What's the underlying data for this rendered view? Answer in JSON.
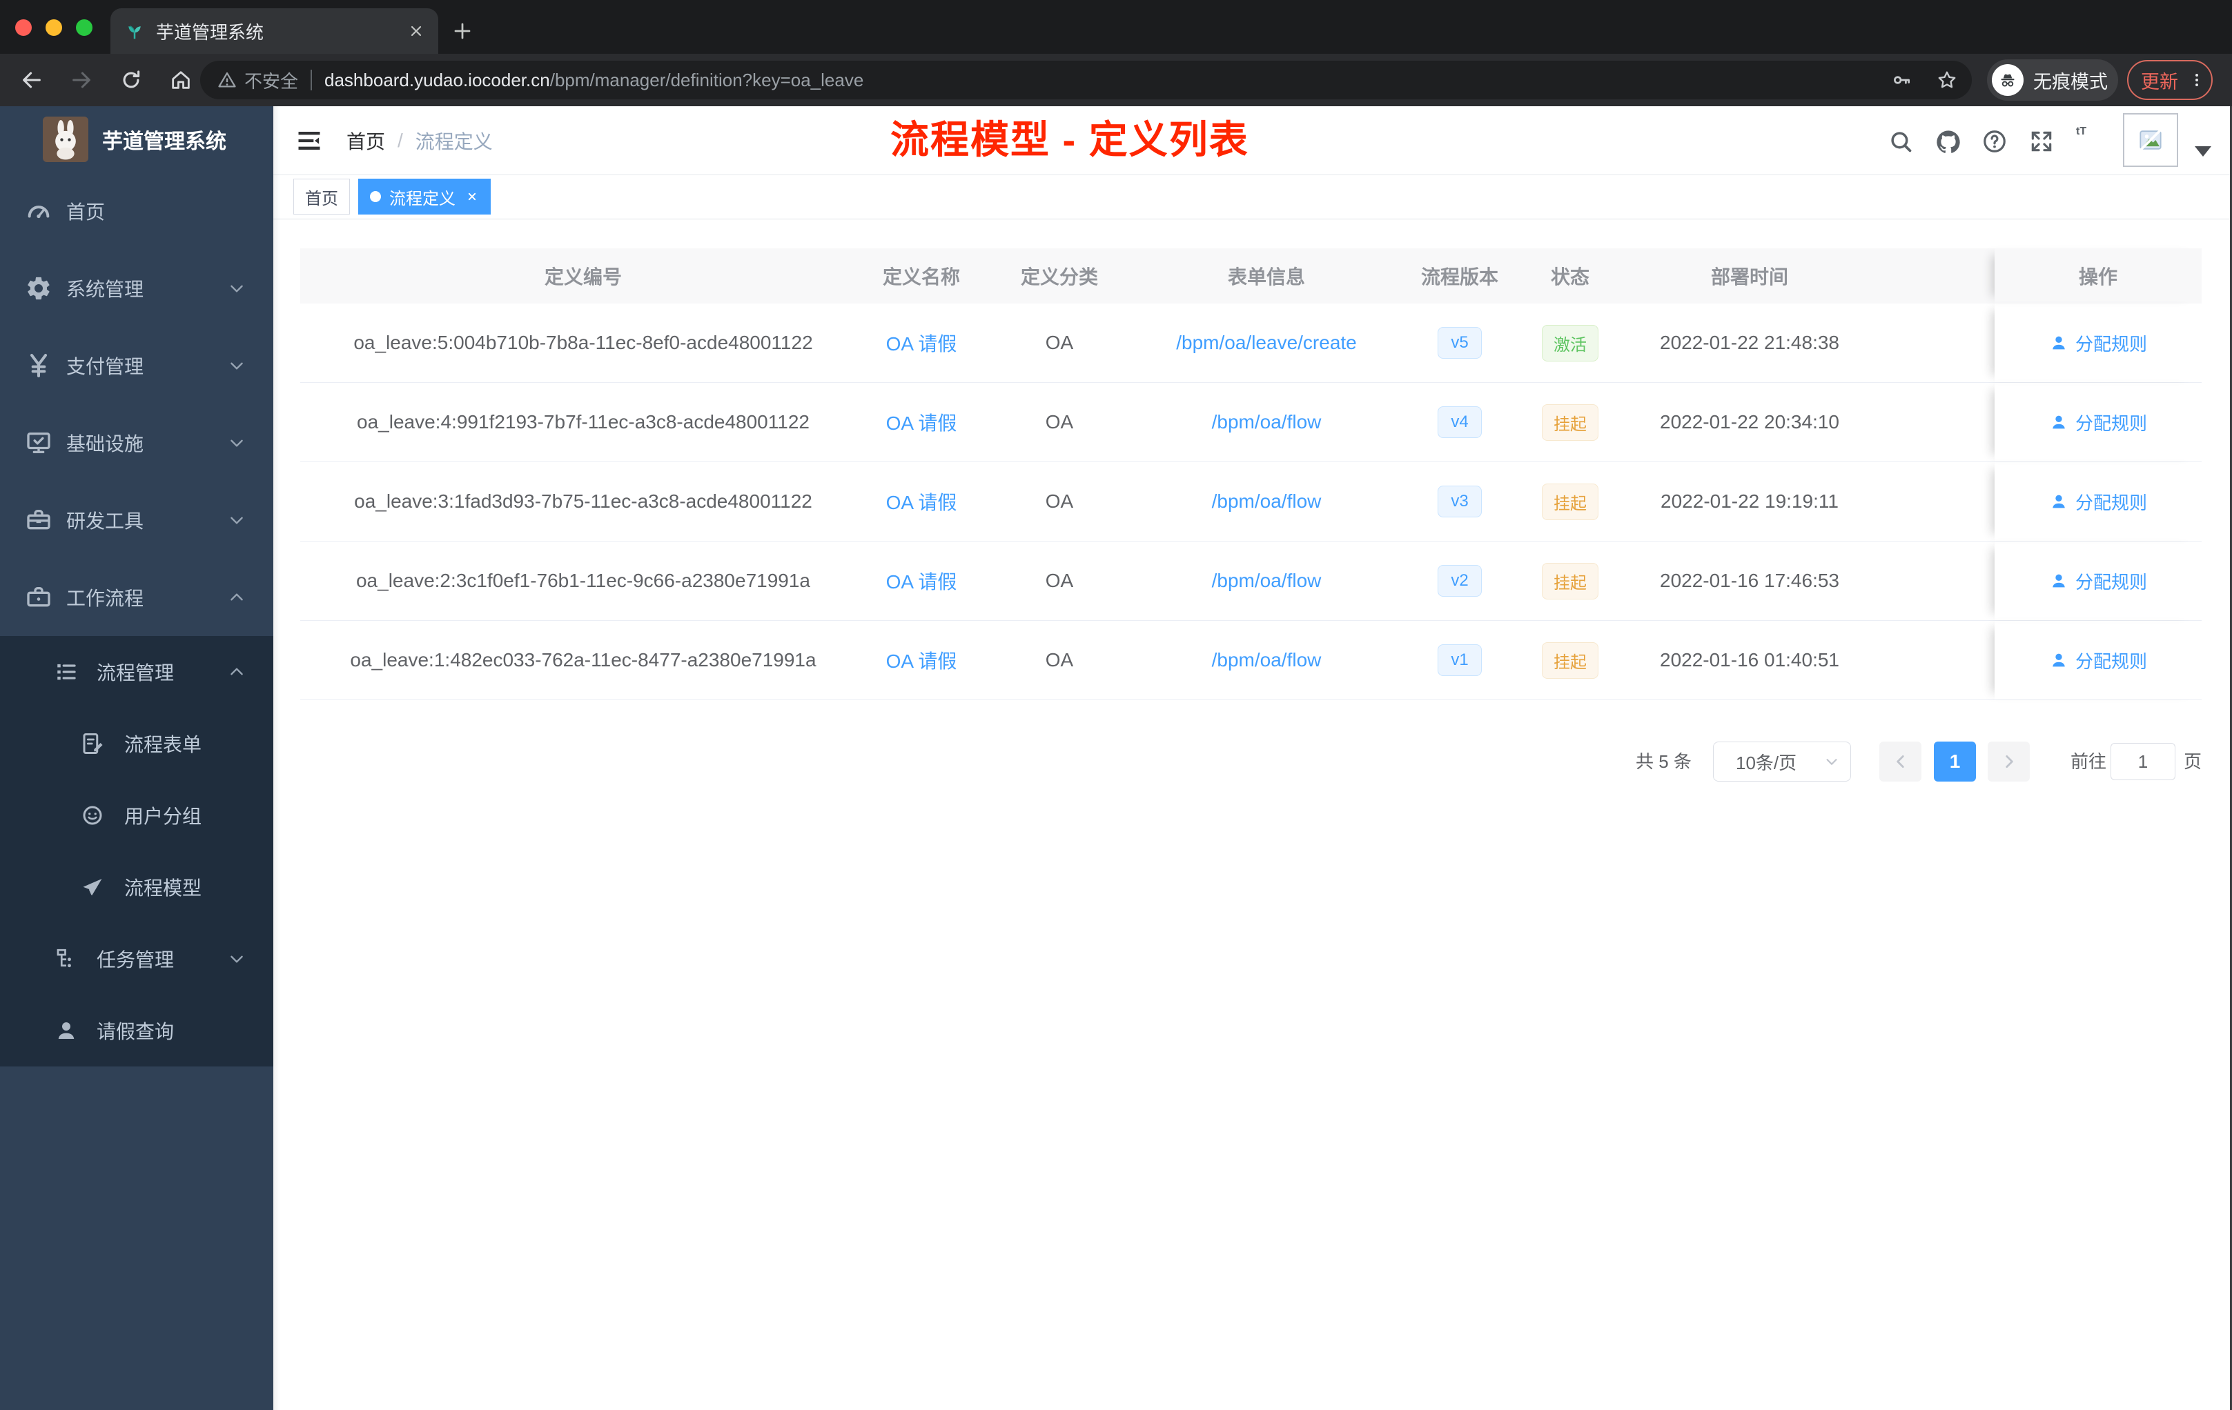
{
  "colors": {
    "accent": "#409eff",
    "success": "#5dc460",
    "warning": "#e6a23c",
    "annotation": "#ff2600",
    "sidebar_bg": "#304156",
    "sidebar_submenu_bg": "#1f2d3d"
  },
  "browser": {
    "tab_title": "芋道管理系统",
    "security_label": "不安全",
    "url_host": "dashboard.yudao.iocoder.cn",
    "url_path": "/bpm/manager/definition?key=oa_leave",
    "incognito_label": "无痕模式",
    "update_label": "更新"
  },
  "sidebar": {
    "logo_title": "芋道管理系统",
    "items": [
      {
        "label": "首页"
      },
      {
        "label": "系统管理"
      },
      {
        "label": "支付管理"
      },
      {
        "label": "基础设施"
      },
      {
        "label": "研发工具"
      },
      {
        "label": "工作流程"
      }
    ],
    "sub_items": [
      {
        "label": "流程管理"
      },
      {
        "label": "流程表单"
      },
      {
        "label": "用户分组"
      },
      {
        "label": "流程模型"
      },
      {
        "label": "任务管理"
      },
      {
        "label": "请假查询"
      }
    ]
  },
  "navbar": {
    "breadcrumb_home": "首页",
    "breadcrumb_separator": "/",
    "breadcrumb_current": "流程定义",
    "annotation_title": "流程模型 - 定义列表",
    "font_size_icon_label": "tT"
  },
  "tags_view": {
    "home_tag": "首页",
    "active_tag": "流程定义"
  },
  "table": {
    "columns": [
      "定义编号",
      "定义名称",
      "定义分类",
      "表单信息",
      "流程版本",
      "状态",
      "部署时间",
      "操作"
    ],
    "rows": [
      {
        "id": "oa_leave:5:004b710b-7b8a-11ec-8ef0-acde48001122",
        "name": "OA 请假",
        "category": "OA",
        "form": "/bpm/oa/leave/create",
        "version": "v5",
        "status": "激活",
        "status_type": "success",
        "deploy_time": "2022-01-22 21:48:38",
        "action": "分配规则"
      },
      {
        "id": "oa_leave:4:991f2193-7b7f-11ec-a3c8-acde48001122",
        "name": "OA 请假",
        "category": "OA",
        "form": "/bpm/oa/flow",
        "version": "v4",
        "status": "挂起",
        "status_type": "warning",
        "deploy_time": "2022-01-22 20:34:10",
        "action": "分配规则"
      },
      {
        "id": "oa_leave:3:1fad3d93-7b75-11ec-a3c8-acde48001122",
        "name": "OA 请假",
        "category": "OA",
        "form": "/bpm/oa/flow",
        "version": "v3",
        "status": "挂起",
        "status_type": "warning",
        "deploy_time": "2022-01-22 19:19:11",
        "action": "分配规则"
      },
      {
        "id": "oa_leave:2:3c1f0ef1-76b1-11ec-9c66-a2380e71991a",
        "name": "OA 请假",
        "category": "OA",
        "form": "/bpm/oa/flow",
        "version": "v2",
        "status": "挂起",
        "status_type": "warning",
        "deploy_time": "2022-01-16 17:46:53",
        "action": "分配规则"
      },
      {
        "id": "oa_leave:1:482ec033-762a-11ec-8477-a2380e71991a",
        "name": "OA 请假",
        "category": "OA",
        "form": "/bpm/oa/flow",
        "version": "v1",
        "status": "挂起",
        "status_type": "warning",
        "deploy_time": "2022-01-16 01:40:51",
        "action": "分配规则"
      }
    ]
  },
  "pagination": {
    "total_label": "共 5 条",
    "page_size_label": "10条/页",
    "current_page": "1",
    "goto_label": "前往",
    "goto_value": "1",
    "page_unit_label": "页"
  }
}
